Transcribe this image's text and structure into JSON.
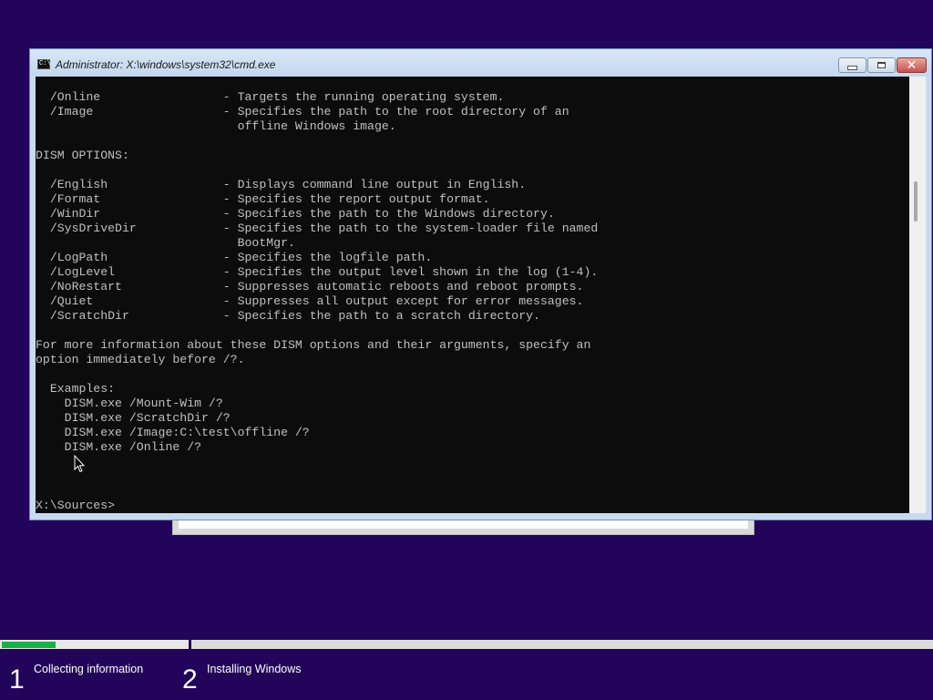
{
  "window": {
    "title": "Administrator: X:\\windows\\system32\\cmd.exe",
    "icon_text": "C:\\",
    "close_glyph": "✕"
  },
  "console": {
    "lines": [
      "  /Online                 - Targets the running operating system.",
      "  /Image                  - Specifies the path to the root directory of an",
      "                            offline Windows image.",
      "",
      "DISM OPTIONS:",
      "",
      "  /English                - Displays command line output in English.",
      "  /Format                 - Specifies the report output format.",
      "  /WinDir                 - Specifies the path to the Windows directory.",
      "  /SysDriveDir            - Specifies the path to the system-loader file named",
      "                            BootMgr.",
      "  /LogPath                - Specifies the logfile path.",
      "  /LogLevel               - Specifies the output level shown in the log (1-4).",
      "  /NoRestart              - Suppresses automatic reboots and reboot prompts.",
      "  /Quiet                  - Suppresses all output except for error messages.",
      "  /ScratchDir             - Specifies the path to a scratch directory.",
      "",
      "For more information about these DISM options and their arguments, specify an",
      "option immediately before /?.",
      "",
      "  Examples:",
      "    DISM.exe /Mount-Wim /?",
      "    DISM.exe /ScratchDir /?",
      "    DISM.exe /Image:C:\\test\\offline /?",
      "    DISM.exe /Online /?",
      "",
      "",
      "",
      "X:\\Sources>"
    ]
  },
  "setup_progress": {
    "progress": 0.29,
    "steps": [
      {
        "number": "1",
        "label": "Collecting information"
      },
      {
        "number": "2",
        "label": "Installing Windows"
      }
    ]
  },
  "colors": {
    "desktop": "#22045a",
    "console_bg": "#0c0c0c",
    "console_text": "#c0c0c0",
    "progress_fill": "#17b04a"
  },
  "icons": [
    "cmd-app-icon",
    "minimize-icon",
    "maximize-icon",
    "close-icon",
    "mouse-pointer-icon"
  ]
}
